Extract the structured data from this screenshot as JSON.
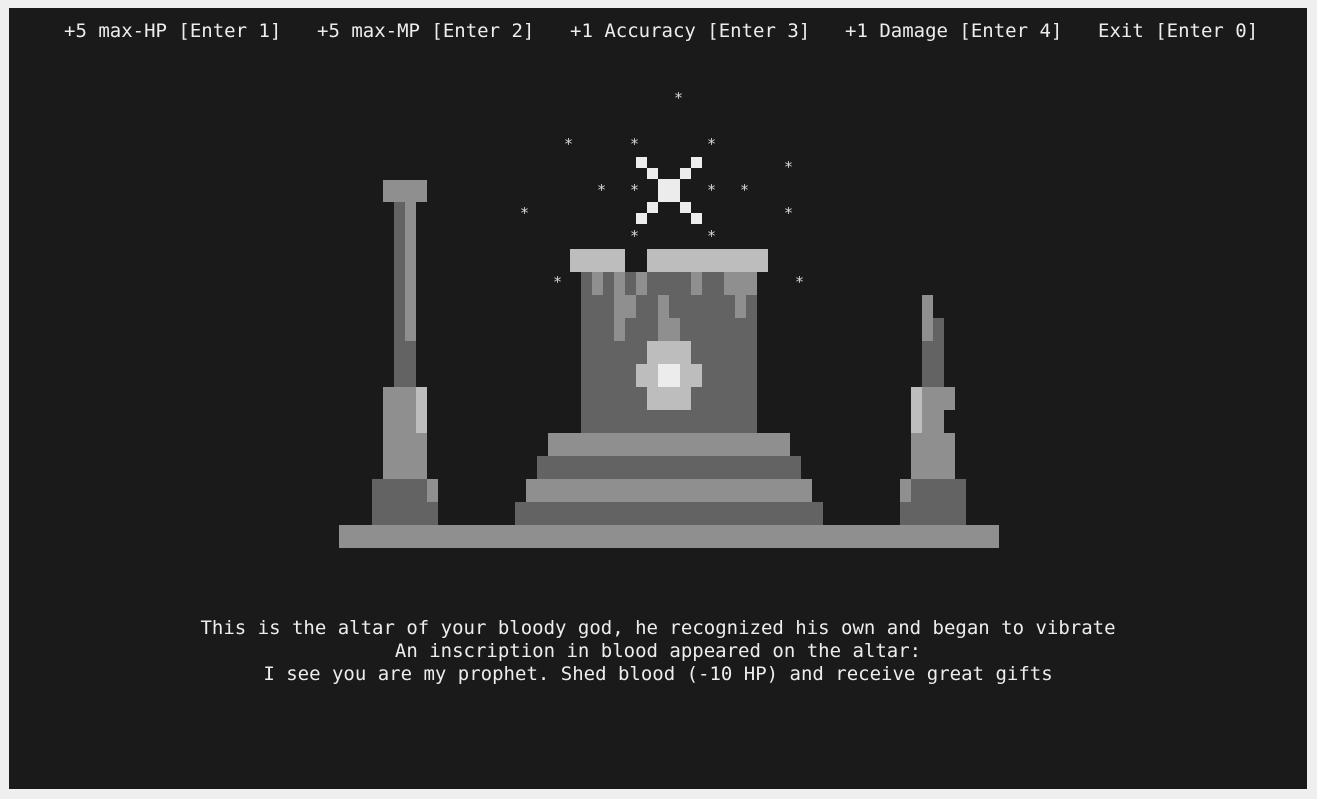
{
  "menu": {
    "items": [
      {
        "label": "+5 max-HP [Enter 1]"
      },
      {
        "label": "+5 max-MP [Enter 2]"
      },
      {
        "label": "+1 Accuracy [Enter 3]"
      },
      {
        "label": "+1 Damage [Enter 4]"
      },
      {
        "label": "Exit [Enter 0]"
      }
    ]
  },
  "scene": {
    "star_glyph": "*",
    "colors": {
      "background": "#1a1a1a",
      "dark_gray": "#636363",
      "mid_gray": "#8f8f8f",
      "light_gray": "#bdbdbd",
      "white": "#ececec"
    }
  },
  "message": {
    "line1": "This is the altar of your bloody god, he recognized his own and began to vibrate",
    "line2": "An inscription in blood appeared on the altar:",
    "line3": "I see you are my prophet. Shed blood (-10 HP) and receive great gifts"
  }
}
